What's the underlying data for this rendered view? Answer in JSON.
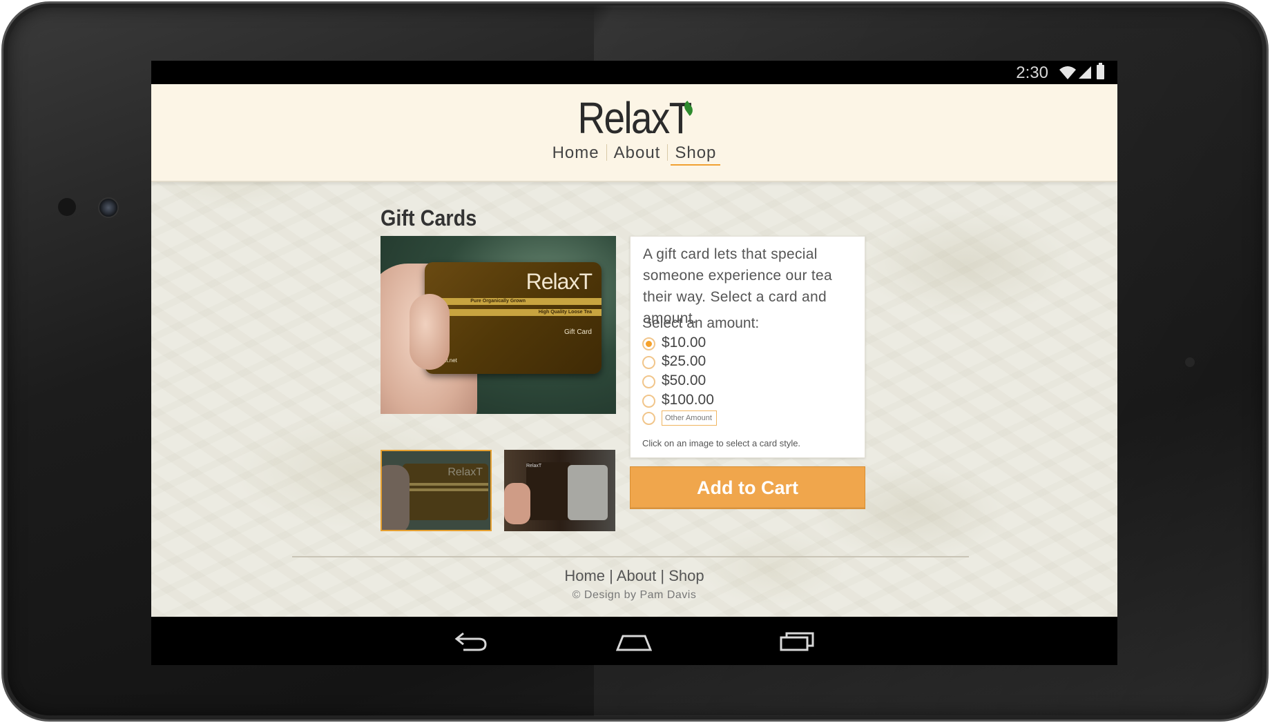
{
  "status_bar": {
    "time": "2:30"
  },
  "site": {
    "logo": "RelaxT",
    "nav": [
      {
        "label": "Home",
        "active": false
      },
      {
        "label": "About",
        "active": false
      },
      {
        "label": "Shop",
        "active": true
      }
    ],
    "accent_color": "#f0a64c"
  },
  "product": {
    "title": "Gift Cards",
    "card_art": {
      "logo": "RelaxT",
      "line1": "Pure Organically Grown",
      "line2": "High Quality Loose Tea",
      "label": "Gift Card",
      "url": "relaxt.net"
    },
    "thumbnails": [
      {
        "name": "card-style-1",
        "selected": true,
        "logo": "RelaxT"
      },
      {
        "name": "card-style-2",
        "selected": false,
        "logo": "RelaxT"
      }
    ],
    "description": "A gift card lets that special someone experience our tea their way. Select a card and amount.",
    "amount_label": "Select an amount:",
    "amounts": [
      {
        "label": "$10.00",
        "checked": true
      },
      {
        "label": "$25.00",
        "checked": false
      },
      {
        "label": "$50.00",
        "checked": false
      },
      {
        "label": "$100.00",
        "checked": false
      }
    ],
    "other_amount_placeholder": "Other Amount",
    "hint": "Click on an image to select a card style.",
    "add_to_cart": "Add to Cart"
  },
  "footer": {
    "nav": [
      "Home",
      "About",
      "Shop"
    ],
    "separator": "|",
    "credit": "© Design by Pam Davis"
  },
  "android_nav": {
    "icons": [
      "back-icon",
      "home-icon",
      "recent-apps-icon"
    ]
  }
}
